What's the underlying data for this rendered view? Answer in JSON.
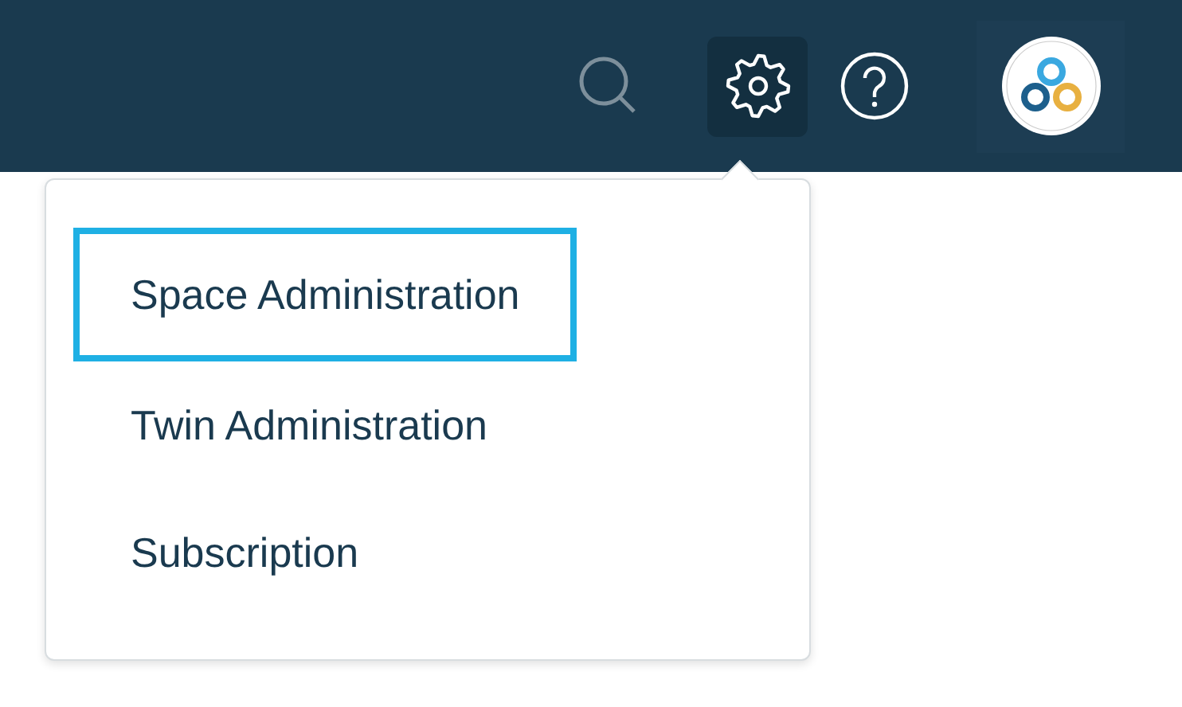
{
  "header": {
    "settings_open": true
  },
  "settings_menu": {
    "items": [
      {
        "label": "Space Administration",
        "selected": true
      },
      {
        "label": "Twin Administration",
        "selected": false
      },
      {
        "label": "Subscription",
        "selected": false
      }
    ]
  }
}
